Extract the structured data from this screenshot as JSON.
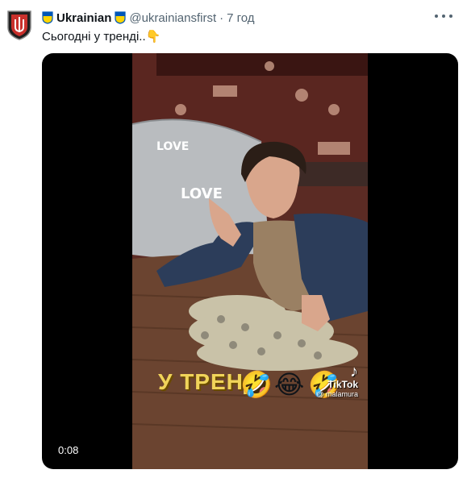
{
  "tweet": {
    "name": "Ukrainian",
    "handle": "@ukrainiansfirst",
    "separator": "·",
    "time": "7 год",
    "text": "Сьогодні у тренді..👇",
    "more_icon": "more-horizontal-icon"
  },
  "video": {
    "timestamp": "0:08",
    "overlay_text": "У ТРЕНДІ",
    "emojis": [
      "🤣",
      "😂",
      "🤣"
    ],
    "tiktok_logo": "TikTok",
    "tiktok_user": "@ malamura"
  },
  "colors": {
    "accent": "#1d9bf0",
    "badge_yellow": "#ffd500",
    "badge_blue": "#0057b7"
  }
}
